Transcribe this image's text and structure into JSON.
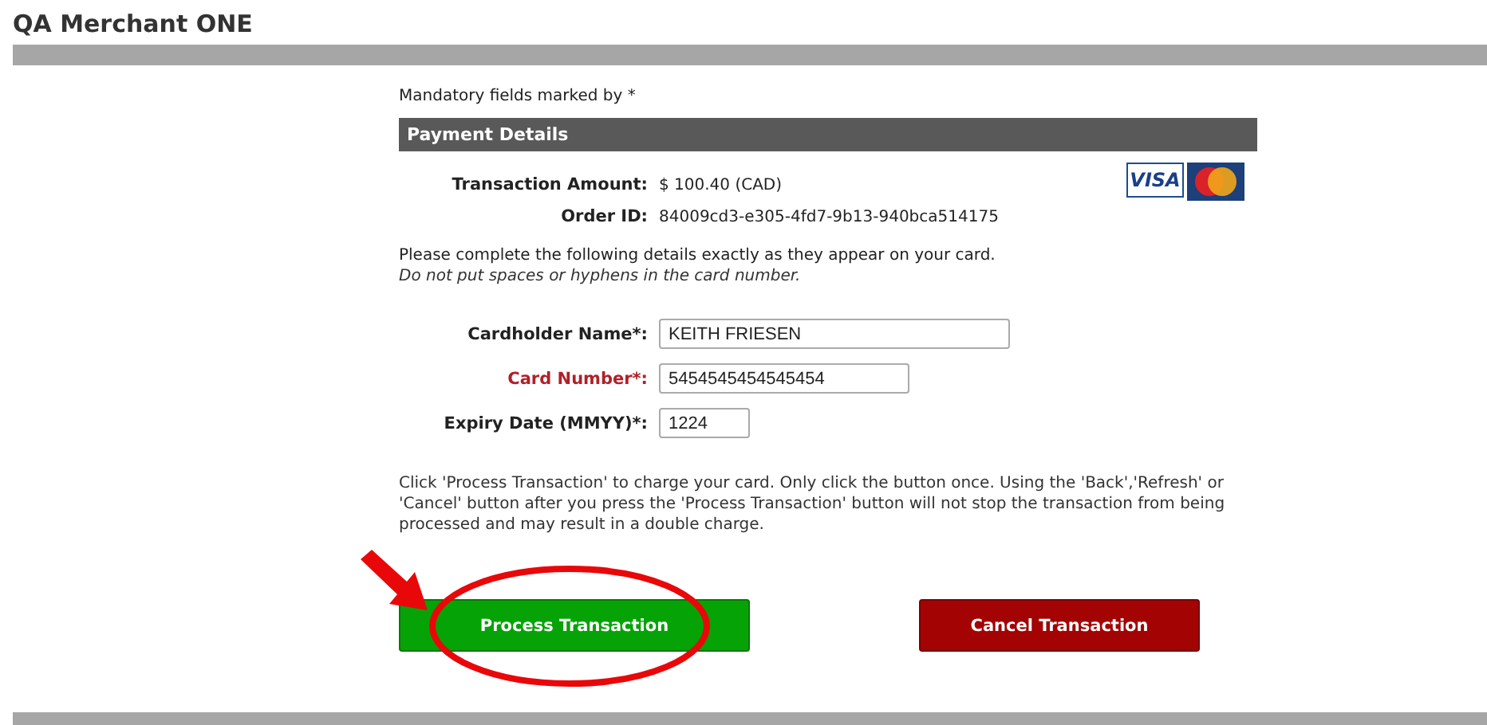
{
  "merchant": {
    "title": "QA Merchant ONE"
  },
  "mandatory_note": "Mandatory fields marked by *",
  "section": {
    "title": "Payment Details"
  },
  "card_logos": {
    "visa": "VISA"
  },
  "summary": [
    {
      "label": "Transaction Amount:",
      "value": "$ 100.40 (CAD)"
    },
    {
      "label": "Order ID:",
      "value": "84009cd3-e305-4fd7-9b13-940bca514175"
    }
  ],
  "instructions": {
    "text": "Please complete the following details exactly as they appear on your card.",
    "note": "Do not put spaces or hyphens in the card number."
  },
  "fields": [
    {
      "label": "Cardholder Name*:",
      "value": "KEITH FRIESEN",
      "invalid": false
    },
    {
      "label": "Card Number*:",
      "value": "5454545454545454",
      "invalid": true
    },
    {
      "label": "Expiry Date (MMYY)*:",
      "value": "1224",
      "invalid": false
    }
  ],
  "warning": "Click 'Process Transaction' to charge your card. Only click the button once. Using the 'Back','Refresh' or 'Cancel' button after you press the 'Process Transaction' button will not stop the transaction from being processed and may result in a double charge.",
  "buttons": [
    {
      "label": "Process Transaction",
      "kind": "process",
      "highlighted": true
    },
    {
      "label": "Cancel Transaction",
      "kind": "cancel",
      "highlighted": false
    }
  ]
}
